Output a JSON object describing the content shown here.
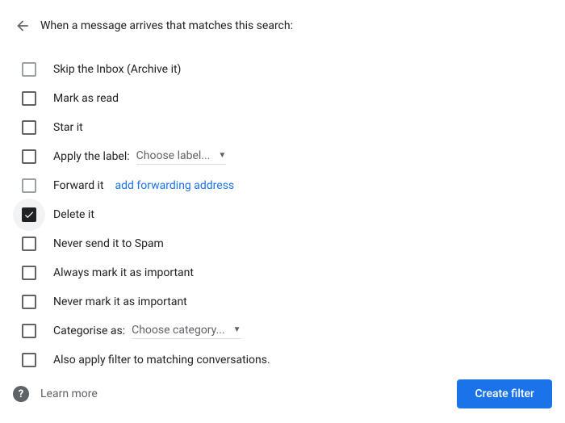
{
  "header": {
    "title": "When a message arrives that matches this search:"
  },
  "options": {
    "skip_inbox": "Skip the Inbox (Archive it)",
    "mark_read": "Mark as read",
    "star": "Star it",
    "apply_label": "Apply the label:",
    "apply_label_dropdown": "Choose label...",
    "forward": "Forward it",
    "forward_link": "add forwarding address",
    "delete": "Delete it",
    "never_spam": "Never send it to Spam",
    "always_important": "Always mark it as important",
    "never_important": "Never mark it as important",
    "categorise": "Categorise as:",
    "categorise_dropdown": "Choose category...",
    "also_apply": "Also apply filter to matching conversations."
  },
  "footer": {
    "learn_more": "Learn more",
    "create_button": "Create filter"
  }
}
